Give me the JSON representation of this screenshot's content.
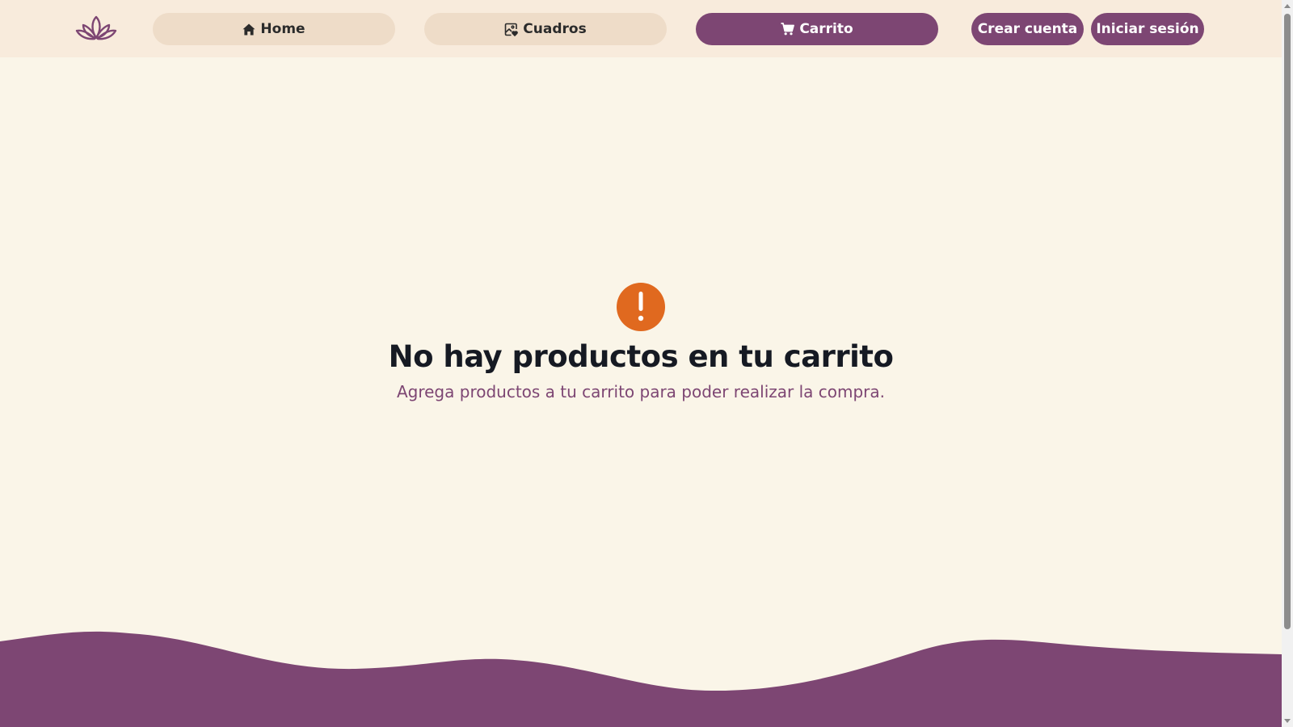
{
  "header": {
    "logo_icon": "lotus-icon",
    "nav": {
      "home_label": "Home",
      "home_icon": "home-icon",
      "cuadros_label": "Cuadros",
      "cuadros_icon": "image-heart-icon",
      "carrito_label": "Carrito",
      "carrito_icon": "cart-icon"
    },
    "auth": {
      "register_label": "Crear cuenta",
      "login_label": "Iniciar sesión"
    }
  },
  "cart": {
    "empty_icon": "exclamation-icon",
    "empty_title": "No hay productos en tu carrito",
    "empty_message": "Agrega productos a tu carrito para poder realizar la compra."
  },
  "colors": {
    "header_bg": "#f8ebdc",
    "page_bg": "#faf5e8",
    "accent_purple": "#7d4673",
    "nav_inactive_bg": "#eedcc8",
    "alert_orange": "#e0691f",
    "title_text": "#161a23"
  }
}
